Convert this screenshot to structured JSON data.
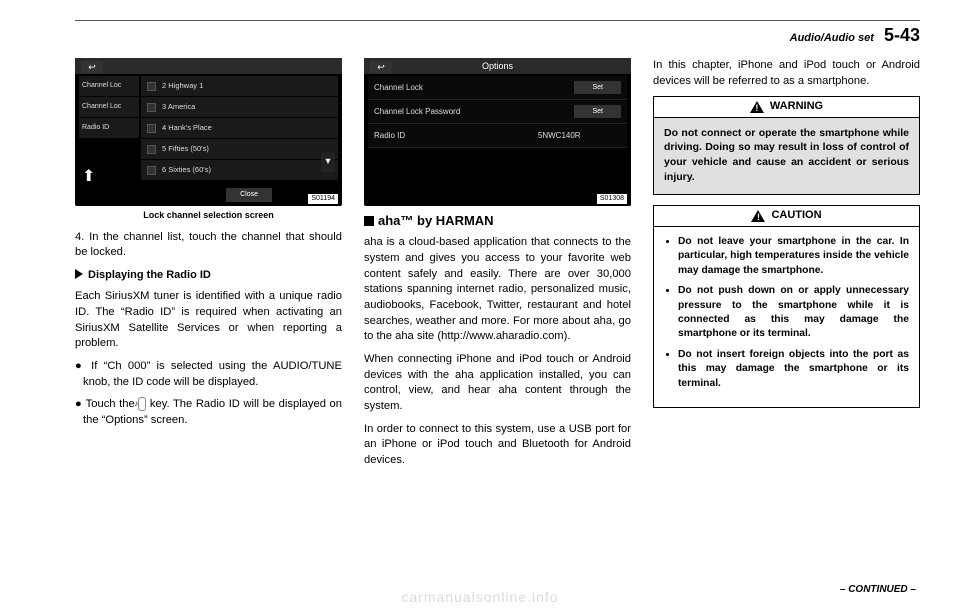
{
  "header": {
    "section": "Audio/Audio set",
    "page": "5-43"
  },
  "col1": {
    "screen1": {
      "side": [
        "Channel Loc",
        "Channel Loc",
        "Radio ID"
      ],
      "rows": [
        "2  Highway 1",
        "3  America",
        "4  Hank's Place",
        "5  Fifties (50's)",
        "6  Sixties (60's)"
      ],
      "close": "Close",
      "imgid": "S01194"
    },
    "caption": "Lock channel selection screen",
    "step4": "4.  In the channel list, touch the channel that should be locked.",
    "subhead": "Displaying the Radio ID",
    "p1": "Each SiriusXM tuner is identified with a unique radio ID. The “Radio ID” is required when activating an SiriusXM Satellite Services or when reporting a problem.",
    "b1": "If “Ch 000” is selected using the AUDIO/TUNE knob, the ID code will be displayed.",
    "b2a": "Touch the ",
    "b2key": "♪",
    "b2b": " key. The Radio ID will be displayed on the “Options” screen."
  },
  "col2": {
    "screen2": {
      "title": "Options",
      "rows": [
        {
          "label": "Channel Lock",
          "btn": "Set"
        },
        {
          "label": "Channel Lock Password",
          "btn": "Set"
        },
        {
          "label": "Radio ID",
          "val": "5NWC140R"
        }
      ],
      "imgid": "S01308"
    },
    "heading": "aha™ by HARMAN",
    "p1": "aha is a cloud-based application that connects to the system and gives you access to your favorite web content safely and easily. There are over 30,000 stations spanning internet radio, personalized music, audiobooks, Facebook, Twitter, restaurant and hotel searches, weather and more. For more about aha, go to the aha site (http://www.aharadio.com).",
    "p2": "When connecting iPhone and iPod touch or Android devices with the aha application installed, you can control, view, and hear aha content through the system.",
    "p3": "In order to connect to this system, use a USB port for an iPhone or iPod touch and Bluetooth for Android devices."
  },
  "col3": {
    "p1": "In this chapter, iPhone and iPod touch or Android devices will be referred to as a smartphone.",
    "warning_title": "WARNING",
    "warning_body": "Do not connect or operate the smartphone while driving. Doing so may result in loss of control of your vehicle and cause an accident or serious injury.",
    "caution_title": "CAUTION",
    "caution_items": [
      "Do not leave your smartphone in the car. In particular, high temperatures inside the vehicle may damage the smartphone.",
      "Do not push down on or apply unnecessary pressure to the smartphone while it is connected as this may damage the smartphone or its terminal.",
      "Do not insert foreign objects into the port as this may damage the smartphone or its terminal."
    ]
  },
  "continued": "– CONTINUED –",
  "watermark": "carmanualsonline.info"
}
